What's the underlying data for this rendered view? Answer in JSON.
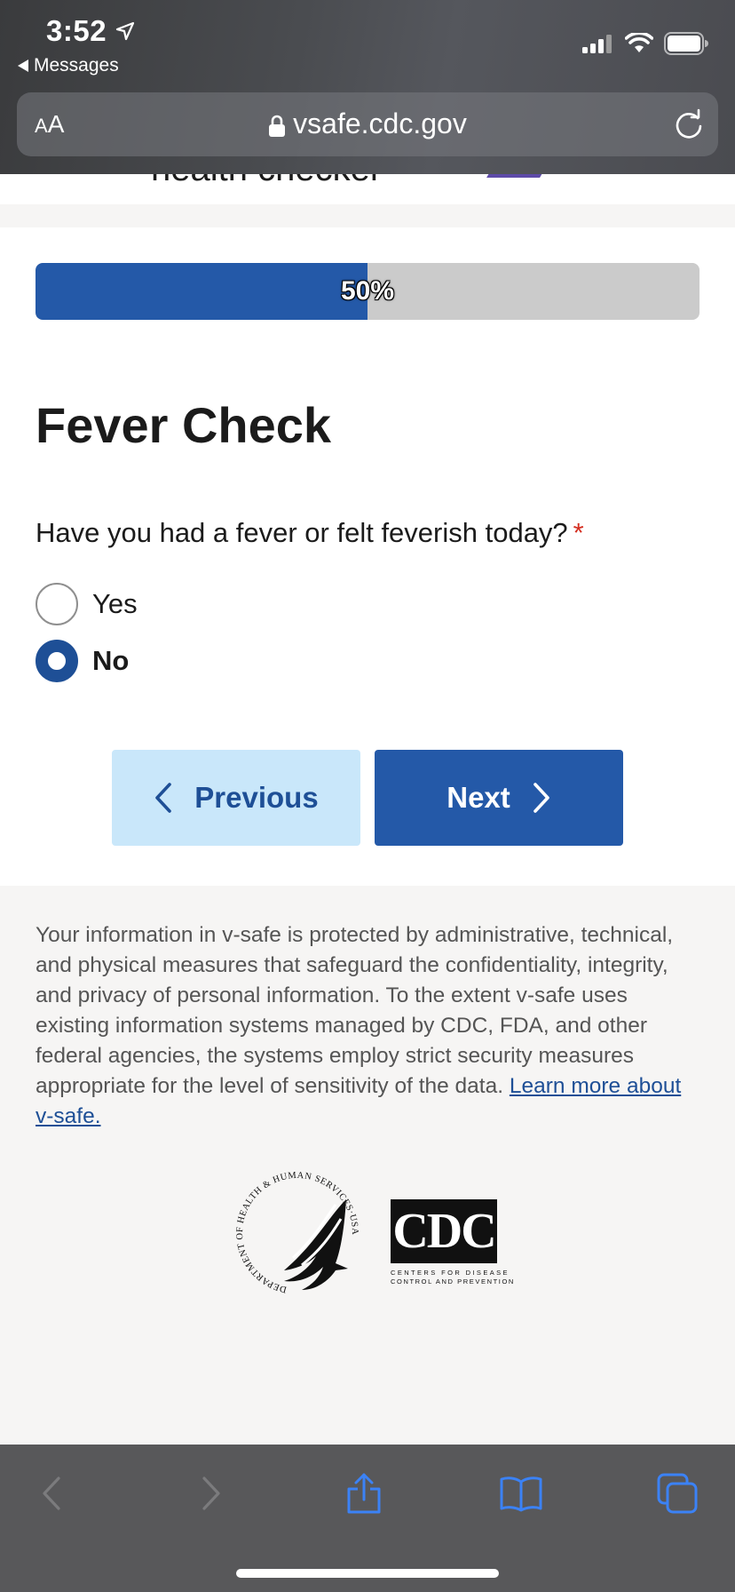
{
  "status_bar": {
    "time": "3:52",
    "back_app_label": "Messages"
  },
  "browser": {
    "text_size_label_small": "A",
    "text_size_label_large": "A",
    "url": "vsafe.cdc.gov"
  },
  "header": {
    "partial_text": "health checker"
  },
  "progress": {
    "percent": 50,
    "label": "50%"
  },
  "form": {
    "title": "Fever Check",
    "question": "Have you had a fever or felt feverish today?",
    "required_marker": "*",
    "options": [
      {
        "label": "Yes",
        "selected": false
      },
      {
        "label": "No",
        "selected": true
      }
    ],
    "previous_label": "Previous",
    "next_label": "Next"
  },
  "footer": {
    "privacy_text": "Your information in v-safe is protected by administrative, technical, and physical measures that safeguard the confidentiality, integrity, and privacy of personal information. To the extent v-safe uses existing information systems managed by CDC, FDA, and other federal agencies, the systems employ strict security measures appropriate for the level of sensitivity of the data. ",
    "link_text": "Learn more about v-safe.",
    "hhs_seal_text": "DEPARTMENT OF HEALTH & HUMAN SERVICES·USA",
    "cdc_logo_text": "CDC",
    "cdc_tagline_1": "Centers for Disease",
    "cdc_tagline_2": "Control and Prevention"
  },
  "colors": {
    "primary_blue": "#2459a8",
    "dark_blue": "#1e4f96",
    "light_blue": "#c9e7fa",
    "required_red": "#d42e20",
    "toolbar_icon_blue": "#3b82f6"
  },
  "icons": [
    "location-arrow-icon",
    "signal-icon",
    "wifi-icon",
    "battery-icon",
    "lock-icon",
    "reload-icon",
    "chevron-left-icon",
    "chevron-right-icon",
    "share-icon",
    "bookmarks-icon",
    "tabs-icon"
  ]
}
